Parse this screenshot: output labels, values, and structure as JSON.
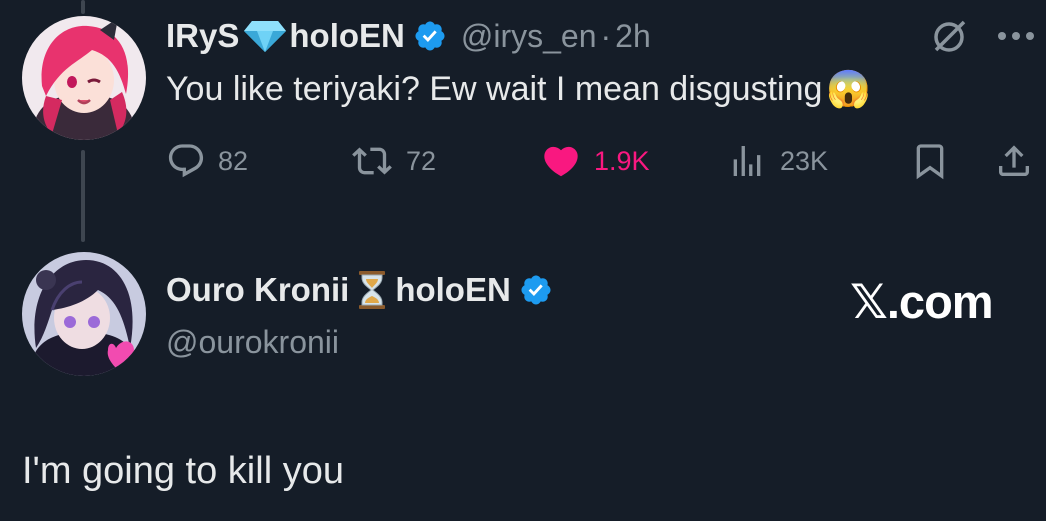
{
  "tweet": {
    "author_name": "IRyS",
    "author_badge_text": "holoEN",
    "handle": "@irys_en",
    "separator": "·",
    "time": "2h",
    "text": "You like teriyaki? Ew wait I mean disgusting",
    "emoji": "😱",
    "stats": {
      "replies": "82",
      "reposts": "72",
      "likes": "1.9K",
      "views": "23K"
    }
  },
  "reply": {
    "author_name": "Ouro Kronii",
    "author_badge_text": "holoEN",
    "handle": "@ourokronii",
    "text": "I'm going to kill you"
  },
  "watermark": {
    "logo": "𝕏",
    "domain": ".com"
  },
  "colors": {
    "background": "#151d28",
    "text": "#e7e9ea",
    "muted": "#8a949d",
    "verified": "#1d9bf0",
    "like": "#f91880"
  },
  "icons": [
    "diamond-icon",
    "verified-icon",
    "grok-icon",
    "more-icon",
    "reply-icon",
    "repost-icon",
    "heart-icon",
    "views-icon",
    "bookmark-icon",
    "share-icon",
    "hourglass-icon"
  ]
}
